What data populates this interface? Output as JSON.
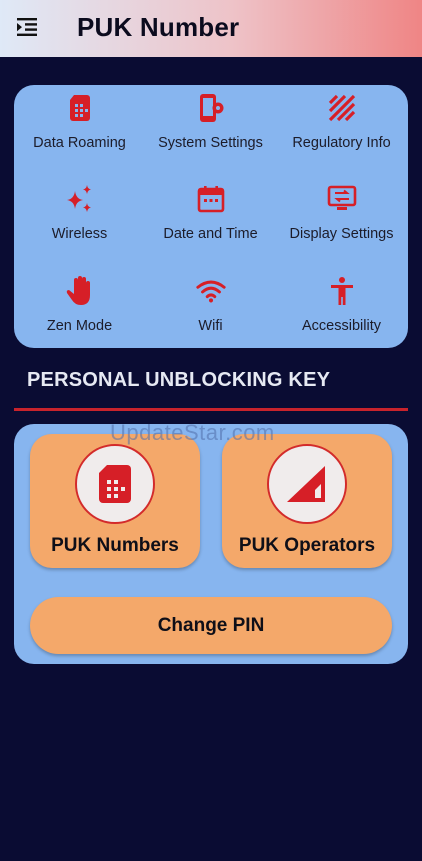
{
  "app": {
    "title": "PUK Number",
    "menu_icon": "menu-open-icon"
  },
  "colors": {
    "background": "#0a0c33",
    "card": "#87b5ef",
    "accent_red": "#d61f27",
    "tile_orange": "#f4a86a",
    "divider": "#c8232c"
  },
  "settings_grid": [
    {
      "label": "Data Roaming",
      "icon": "sim-card-icon"
    },
    {
      "label": "System Settings",
      "icon": "phone-settings-icon"
    },
    {
      "label": "Regulatory Info",
      "icon": "hatched-pattern-icon"
    },
    {
      "label": "Wireless",
      "icon": "sparkle-icon"
    },
    {
      "label": "Date and Time",
      "icon": "calendar-icon"
    },
    {
      "label": "Display Settings",
      "icon": "display-settings-icon"
    },
    {
      "label": "Zen Mode",
      "icon": "hand-icon"
    },
    {
      "label": "Wifi",
      "icon": "wifi-icon"
    },
    {
      "label": "Accessibility",
      "icon": "accessibility-icon"
    }
  ],
  "section": {
    "title": "PERSONAL UNBLOCKING KEY"
  },
  "puk": {
    "numbers_label": "PUK Numbers",
    "numbers_icon": "sim-card-icon",
    "operators_label": "PUK Operators",
    "operators_icon": "signal-icon",
    "change_pin_label": "Change PIN"
  },
  "watermark": "UpdateStar.com"
}
